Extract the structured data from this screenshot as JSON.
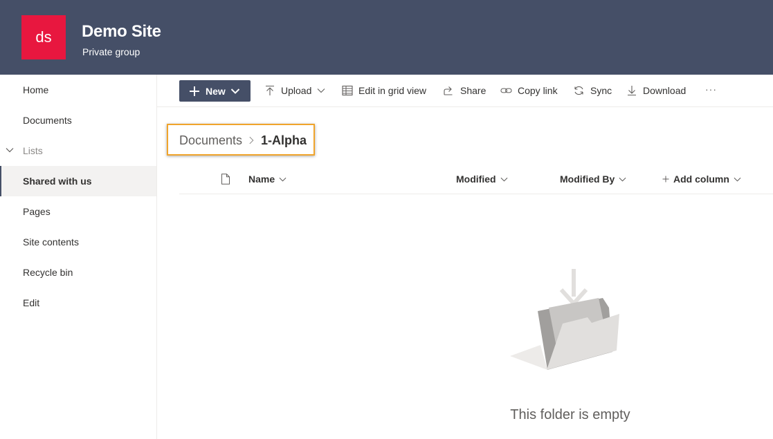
{
  "site": {
    "logo_text": "ds",
    "title": "Demo Site",
    "subtitle": "Private group"
  },
  "nav": {
    "items": [
      {
        "label": "Home"
      },
      {
        "label": "Documents"
      },
      {
        "label": "Lists"
      },
      {
        "label": "Shared with us"
      },
      {
        "label": "Pages"
      },
      {
        "label": "Site contents"
      },
      {
        "label": "Recycle bin"
      },
      {
        "label": "Edit"
      }
    ],
    "selected": "Shared with us"
  },
  "toolbar": {
    "new_label": "New",
    "upload_label": "Upload",
    "grid_label": "Edit in grid view",
    "share_label": "Share",
    "copy_link_label": "Copy link",
    "sync_label": "Sync",
    "download_label": "Download",
    "more_label": "···"
  },
  "breadcrumb": {
    "parent": "Documents",
    "current": "1-Alpha"
  },
  "columns": {
    "name": "Name",
    "modified": "Modified",
    "modified_by": "Modified By",
    "add_column": "Add column"
  },
  "empty": {
    "message": "This folder is empty"
  },
  "colors": {
    "header_bg": "#454f67",
    "logo_bg": "#e8173f",
    "highlight_border": "#f0a42b"
  }
}
